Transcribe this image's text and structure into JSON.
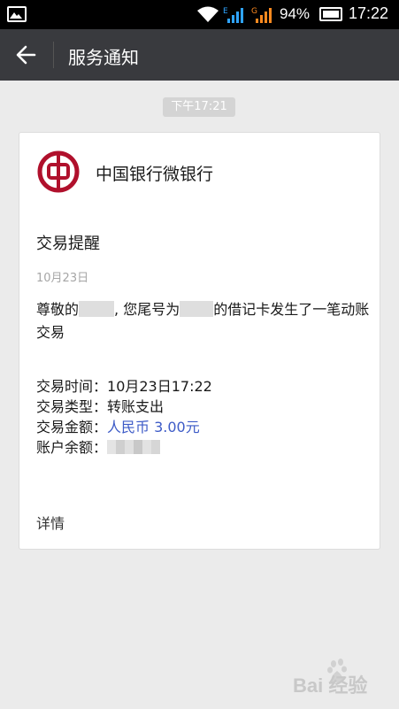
{
  "status_bar": {
    "battery_percent": "94%",
    "time": "17:22",
    "signal_labels": [
      "E",
      "G"
    ]
  },
  "header": {
    "title": "服务通知"
  },
  "conversation": {
    "time_chip": "下午17:21"
  },
  "card": {
    "bank_name": "中国银行微银行",
    "title": "交易提醒",
    "date": "10月23日",
    "body_prefix": "尊敬的",
    "body_middle": ", 您尾号为",
    "body_suffix": "的借记卡发生了一笔动账交易",
    "details": [
      {
        "label": "交易时间：",
        "value": "10月23日17:22"
      },
      {
        "label": "交易类型：",
        "value": "转账支出"
      },
      {
        "label": "交易金额：",
        "value": "人民币 3.00元"
      },
      {
        "label": "账户余额：",
        "value": ""
      }
    ],
    "detail_link": "详情"
  },
  "watermark": {
    "text": "Bai 经验"
  },
  "colors": {
    "header_bg": "#393a3e",
    "page_bg": "#ebebeb",
    "bank_red": "#b0102c",
    "amount_blue": "#3d5bc7"
  }
}
